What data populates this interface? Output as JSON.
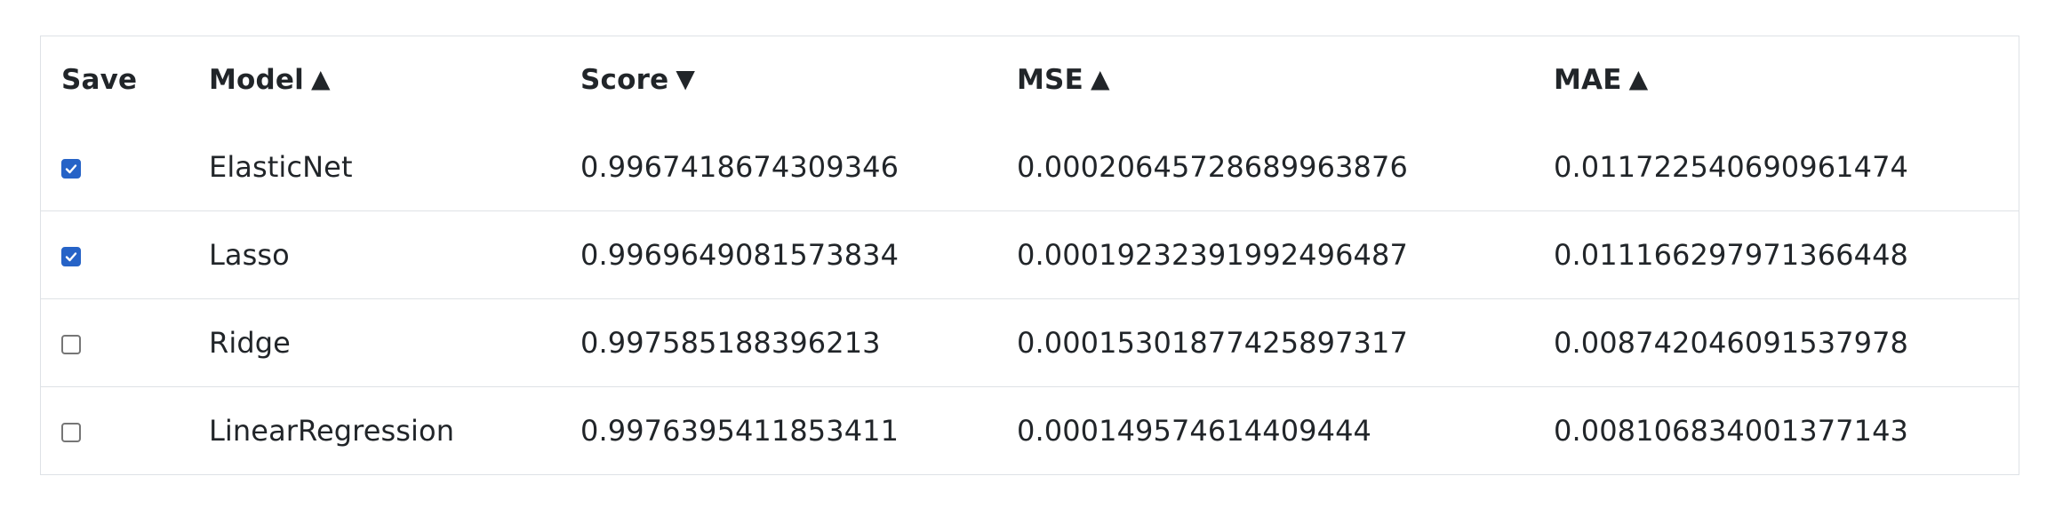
{
  "columns": {
    "save": {
      "label": "Save"
    },
    "model": {
      "label": "Model",
      "sort": "▲"
    },
    "score": {
      "label": "Score",
      "sort": "▼"
    },
    "mse": {
      "label": "MSE",
      "sort": "▲"
    },
    "mae": {
      "label": "MAE",
      "sort": "▲"
    }
  },
  "rows": [
    {
      "saved": true,
      "model": "ElasticNet",
      "score": "0.9967418674309346",
      "mse": "0.00020645728689963876",
      "mae": "0.011722540690961474"
    },
    {
      "saved": true,
      "model": "Lasso",
      "score": "0.9969649081573834",
      "mse": "0.00019232391992496487",
      "mae": "0.011166297971366448"
    },
    {
      "saved": false,
      "model": "Ridge",
      "score": "0.997585188396213",
      "mse": "0.00015301877425897317",
      "mae": "0.008742046091537978"
    },
    {
      "saved": false,
      "model": "LinearRegression",
      "score": "0.9976395411853411",
      "mse": "0.000149574614409444",
      "mae": "0.008106834001377143"
    }
  ],
  "colors": {
    "checkbox_checked": "#2663c7",
    "border": "#dee2e6",
    "text": "#212529"
  }
}
